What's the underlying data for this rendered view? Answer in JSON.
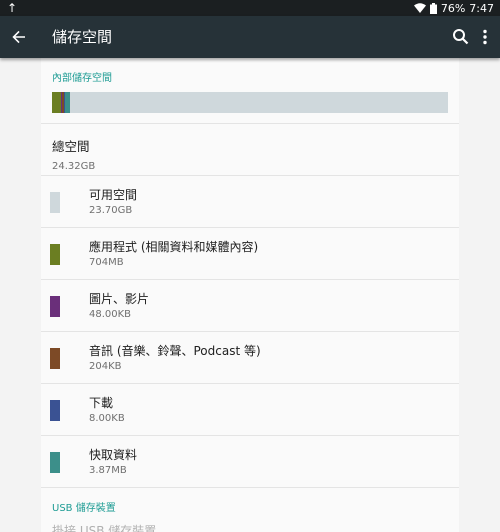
{
  "status_bar": {
    "battery": "76%",
    "time": "7:47"
  },
  "app_bar": {
    "title": "儲存空間"
  },
  "internal": {
    "header": "內部儲存空間",
    "usage_bar": [
      {
        "fraction": 0.0237,
        "color": "#6b7e22"
      },
      {
        "fraction": 0.0008,
        "color": "#6a2f7a"
      },
      {
        "fraction": 0.0068,
        "color": "#7d4a26"
      },
      {
        "fraction": 0.0006,
        "color": "#3a5293"
      },
      {
        "fraction": 0.0136,
        "color": "#3c8f8a"
      },
      {
        "fraction": 0.955,
        "color": "#cfd8dc"
      }
    ],
    "total": {
      "title": "總空間",
      "value": "24.32GB"
    },
    "categories": [
      {
        "label": "可用空間",
        "size": "23.70GB",
        "color": "#cfd8dc"
      },
      {
        "label": "應用程式 (相關資料和媒體內容)",
        "size": "704MB",
        "color": "#6b7e22"
      },
      {
        "label": "圖片、影片",
        "size": "48.00KB",
        "color": "#6a2f7a"
      },
      {
        "label": "音訊 (音樂、鈴聲、Podcast 等)",
        "size": "204KB",
        "color": "#7d4a26"
      },
      {
        "label": "下載",
        "size": "8.00KB",
        "color": "#3a5293"
      },
      {
        "label": "快取資料",
        "size": "3.87MB",
        "color": "#3c8f8a"
      }
    ]
  },
  "usb": {
    "header": "USB 儲存裝置",
    "mount_label": "掛接 USB 儲存裝置"
  }
}
